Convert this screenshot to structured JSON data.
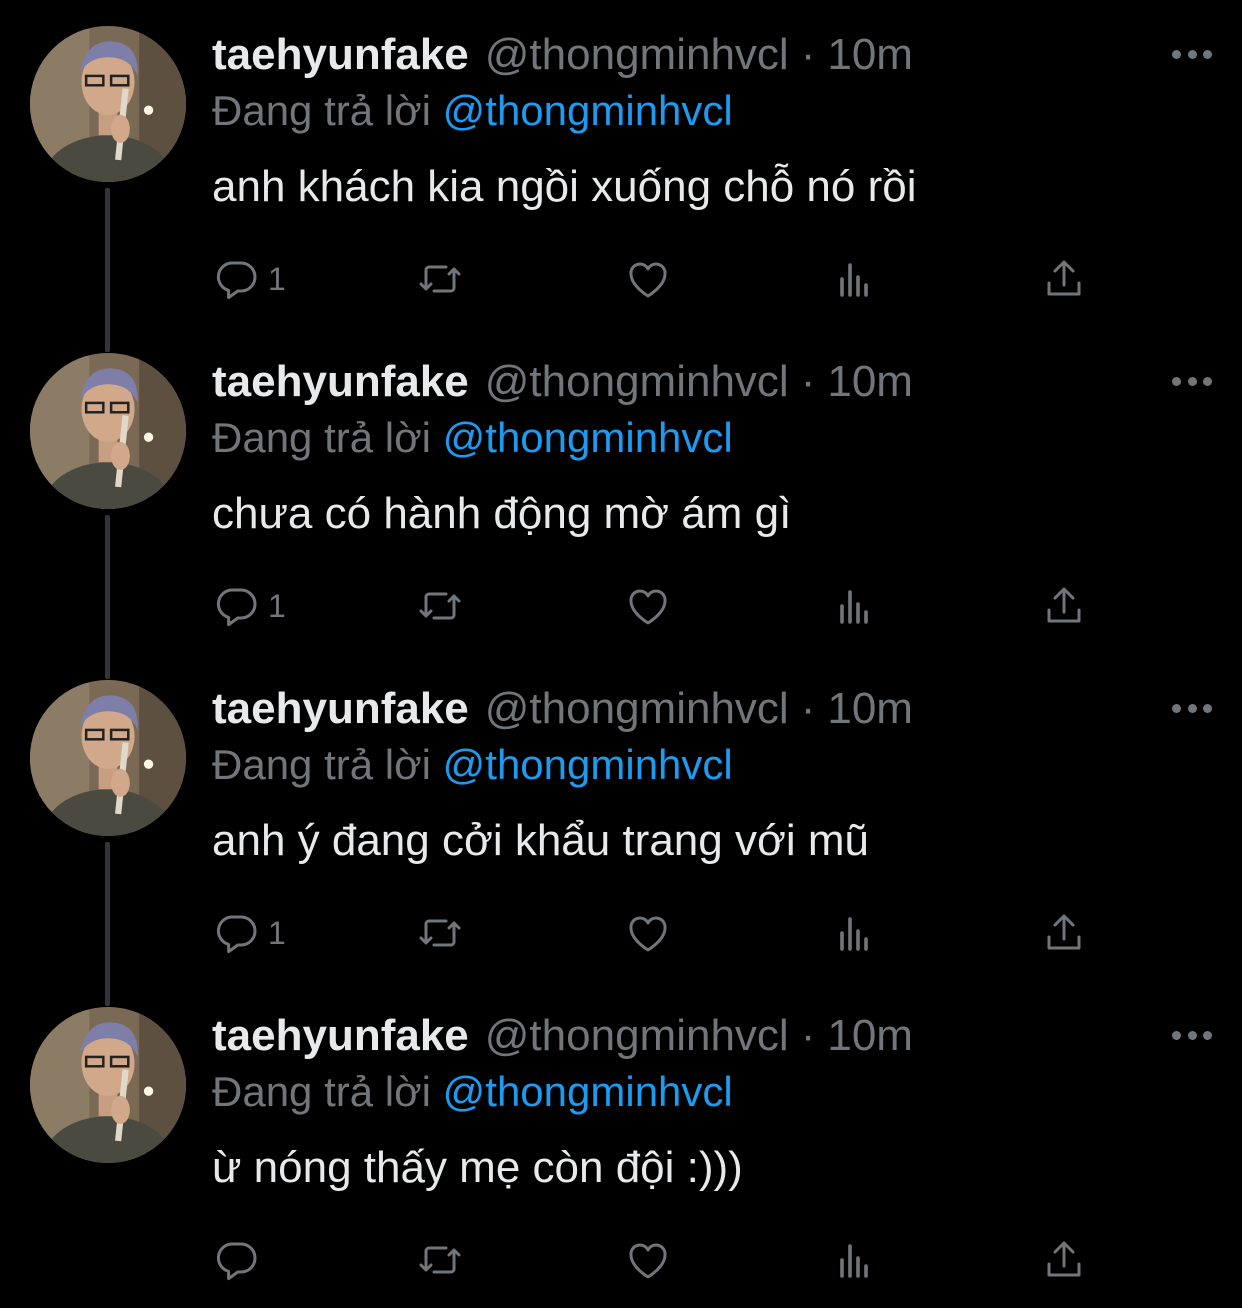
{
  "tweets": [
    {
      "name": "taehyunfake",
      "handle": "@thongminhvcl",
      "separator": "·",
      "time": "10m",
      "reply_prefix": "Đang trả lời",
      "reply_mention": "@thongminhvcl",
      "text": "anh khách kia ngồi xuống chỗ nó rồi",
      "reply_count": "1"
    },
    {
      "name": "taehyunfake",
      "handle": "@thongminhvcl",
      "separator": "·",
      "time": "10m",
      "reply_prefix": "Đang trả lời",
      "reply_mention": "@thongminhvcl",
      "text": "chưa có hành động mờ ám gì",
      "reply_count": "1"
    },
    {
      "name": "taehyunfake",
      "handle": "@thongminhvcl",
      "separator": "·",
      "time": "10m",
      "reply_prefix": "Đang trả lời",
      "reply_mention": "@thongminhvcl",
      "text": "anh ý đang cởi khẩu trang với mũ",
      "reply_count": "1"
    },
    {
      "name": "taehyunfake",
      "handle": "@thongminhvcl",
      "separator": "·",
      "time": "10m",
      "reply_prefix": "Đang trả lời",
      "reply_mention": "@thongminhvcl",
      "text": "ừ nóng thấy mẹ còn đội :)))",
      "reply_count": ""
    }
  ],
  "icons": {
    "reply": "reply-icon",
    "retweet": "retweet-icon",
    "like": "heart-icon",
    "views": "views-icon",
    "share": "share-icon",
    "more": "more-icon"
  },
  "colors": {
    "background": "#000000",
    "text": "#e7e9ea",
    "secondary": "#71767b",
    "accent": "#1d9bf0",
    "thread_line": "#333639"
  }
}
